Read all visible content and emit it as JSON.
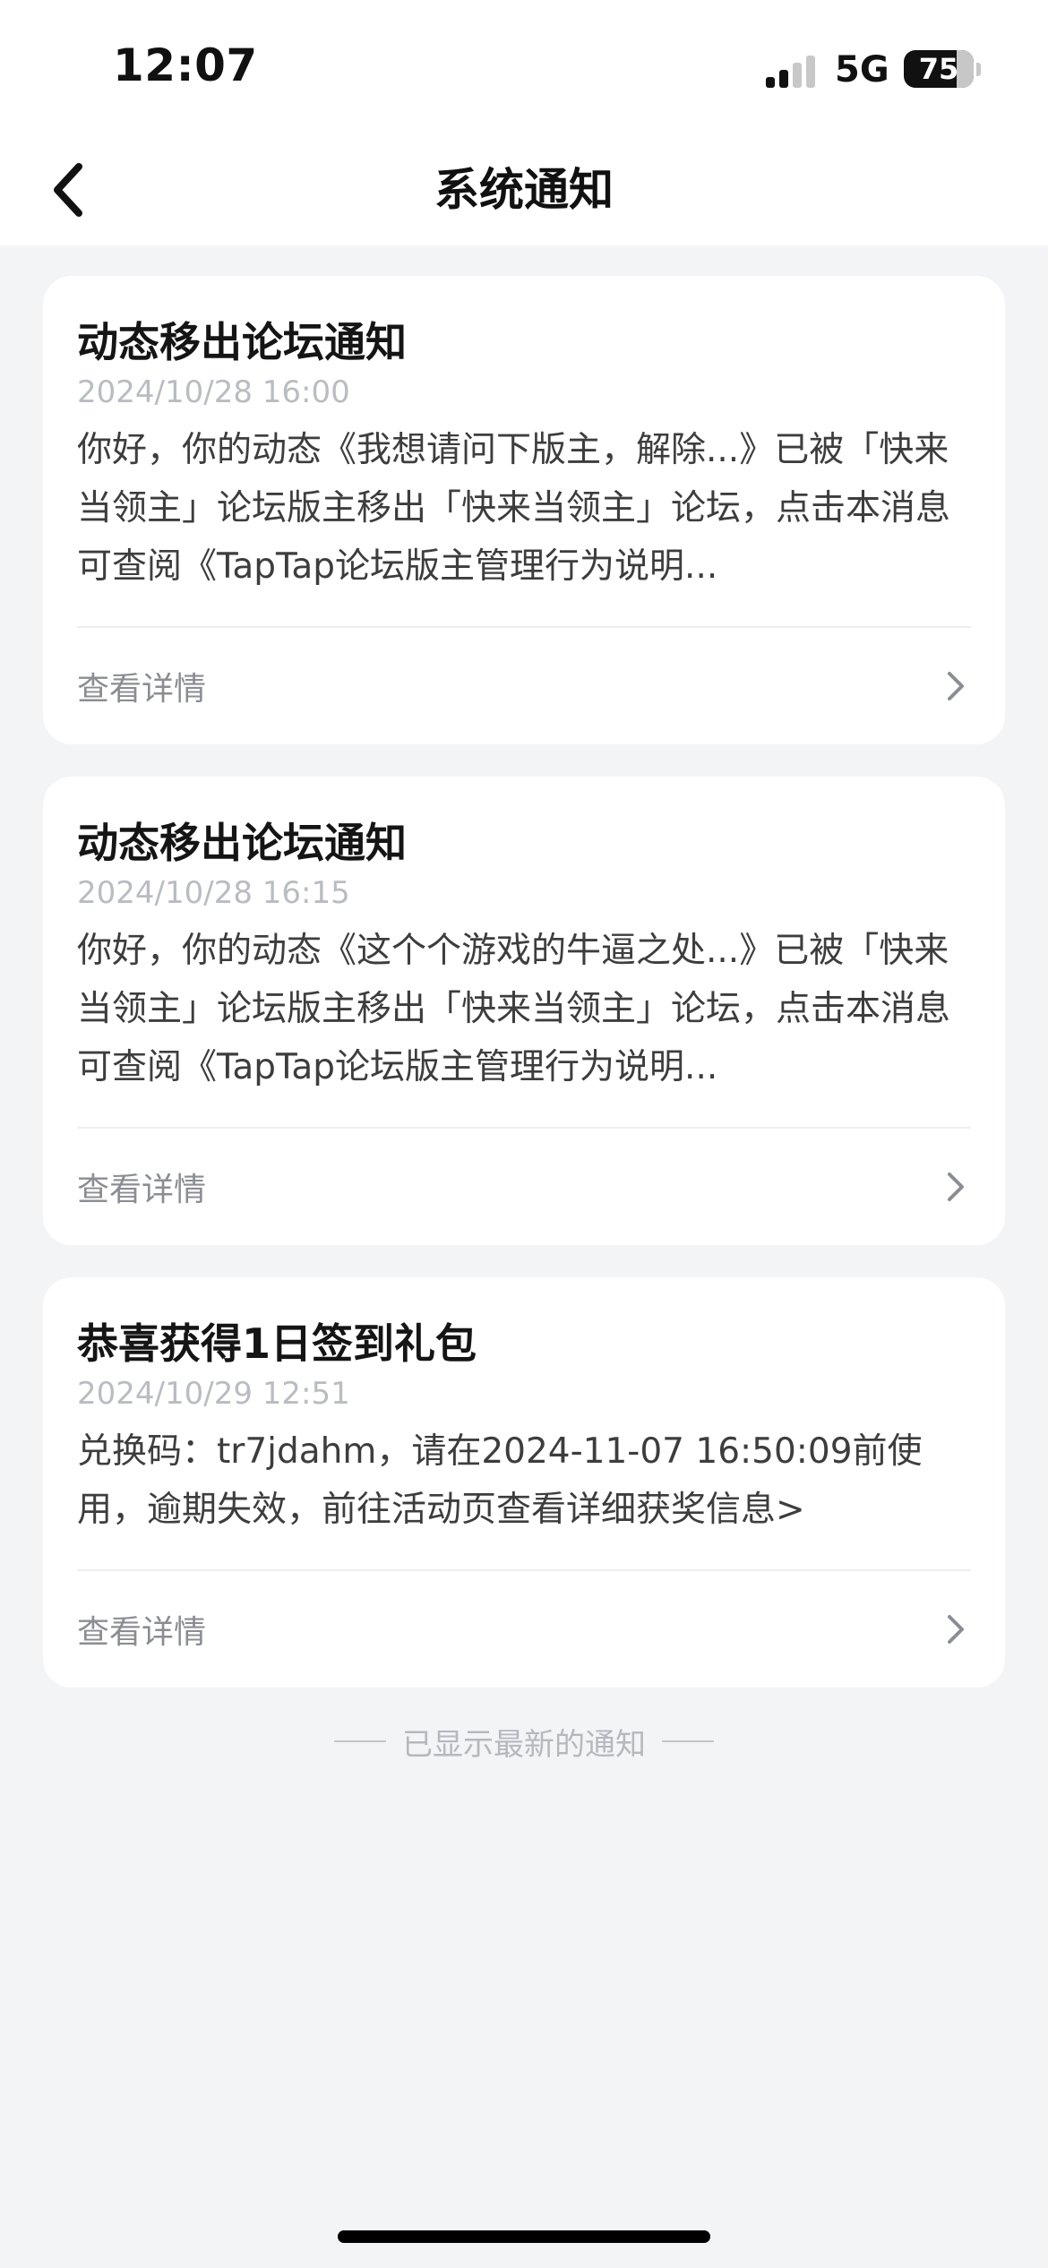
{
  "status_bar": {
    "time": "12:07",
    "network": "5G",
    "battery": "75",
    "battery_level_percent": 75
  },
  "header": {
    "title": "系统通知",
    "back_icon": "chevron-left-icon"
  },
  "notifications": [
    {
      "title": "动态移出论坛通知",
      "time": "2024/10/28 16:00",
      "content": "你好，你的动态《我想请问下版主，解除...》已被「快来当领主」论坛版主移出「快来当领主」论坛，点击本消息可查阅《TapTap论坛版主管理行为说明...",
      "action_label": "查看详情"
    },
    {
      "title": "动态移出论坛通知",
      "time": "2024/10/28 16:15",
      "content": "你好，你的动态《这个个游戏的牛逼之处...》已被「快来当领主」论坛版主移出「快来当领主」论坛，点击本消息可查阅《TapTap论坛版主管理行为说明...",
      "action_label": "查看详情"
    },
    {
      "title": "恭喜获得1日签到礼包",
      "time": "2024/10/29 12:51",
      "content": "兑换码：tr7jdahm，请在2024-11-07 16:50:09前使用，逾期失效，前往活动页查看详细获奖信息>",
      "action_label": "查看详情"
    }
  ],
  "footer": {
    "end_text": "已显示最新的通知"
  },
  "colors": {
    "background": "#f3f4f6",
    "card": "#ffffff",
    "title": "#151515",
    "timestamp": "#b9bcc2",
    "body_text": "#3d3d3d",
    "action_text": "#8a8d93"
  }
}
